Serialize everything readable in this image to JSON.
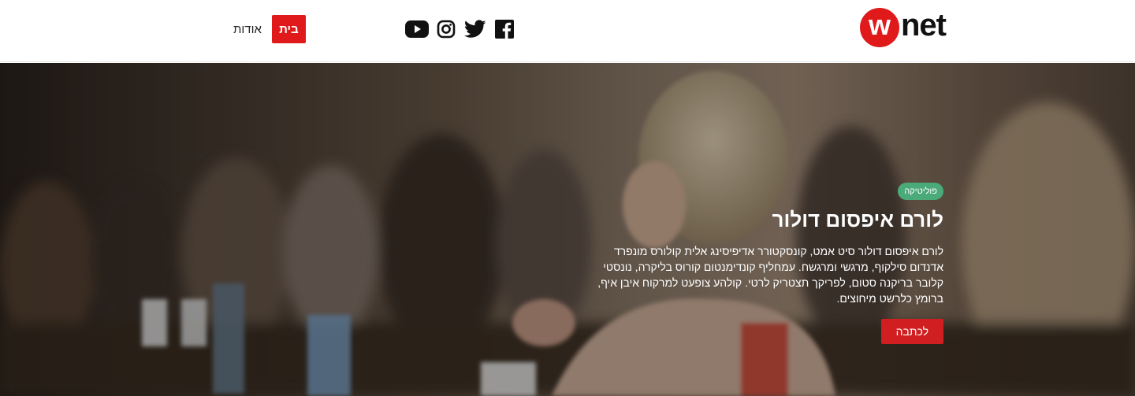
{
  "header": {
    "logo": {
      "mark": "w",
      "text": "net"
    },
    "nav": {
      "home_label": "בית",
      "about_label": "אודות"
    },
    "social": [
      {
        "name": "youtube-icon"
      },
      {
        "name": "instagram-icon"
      },
      {
        "name": "twitter-icon"
      },
      {
        "name": "facebook-icon"
      }
    ]
  },
  "hero": {
    "badge": "פוליטיקה",
    "title": "לורם איפסום דולור",
    "text": "לורם איפסום דולור סיט אמט, קונסקטורר אדיפיסינג אלית קולורס מונפרד אדנדום סילקוף, מרגשי ומרגשח. עמחליף קונדימנטום קורוס בליקרה, נונסטי קלובר בריקנה סטום, לפריקך תצטריק לרטי. קולהע צופעט למרקוח איבן איף, ברומץ כלרשט מיחוצים.",
    "button_label": "לכתבה"
  },
  "colors": {
    "brand_red": "#e0191b",
    "badge_green": "#4aaa7a"
  }
}
